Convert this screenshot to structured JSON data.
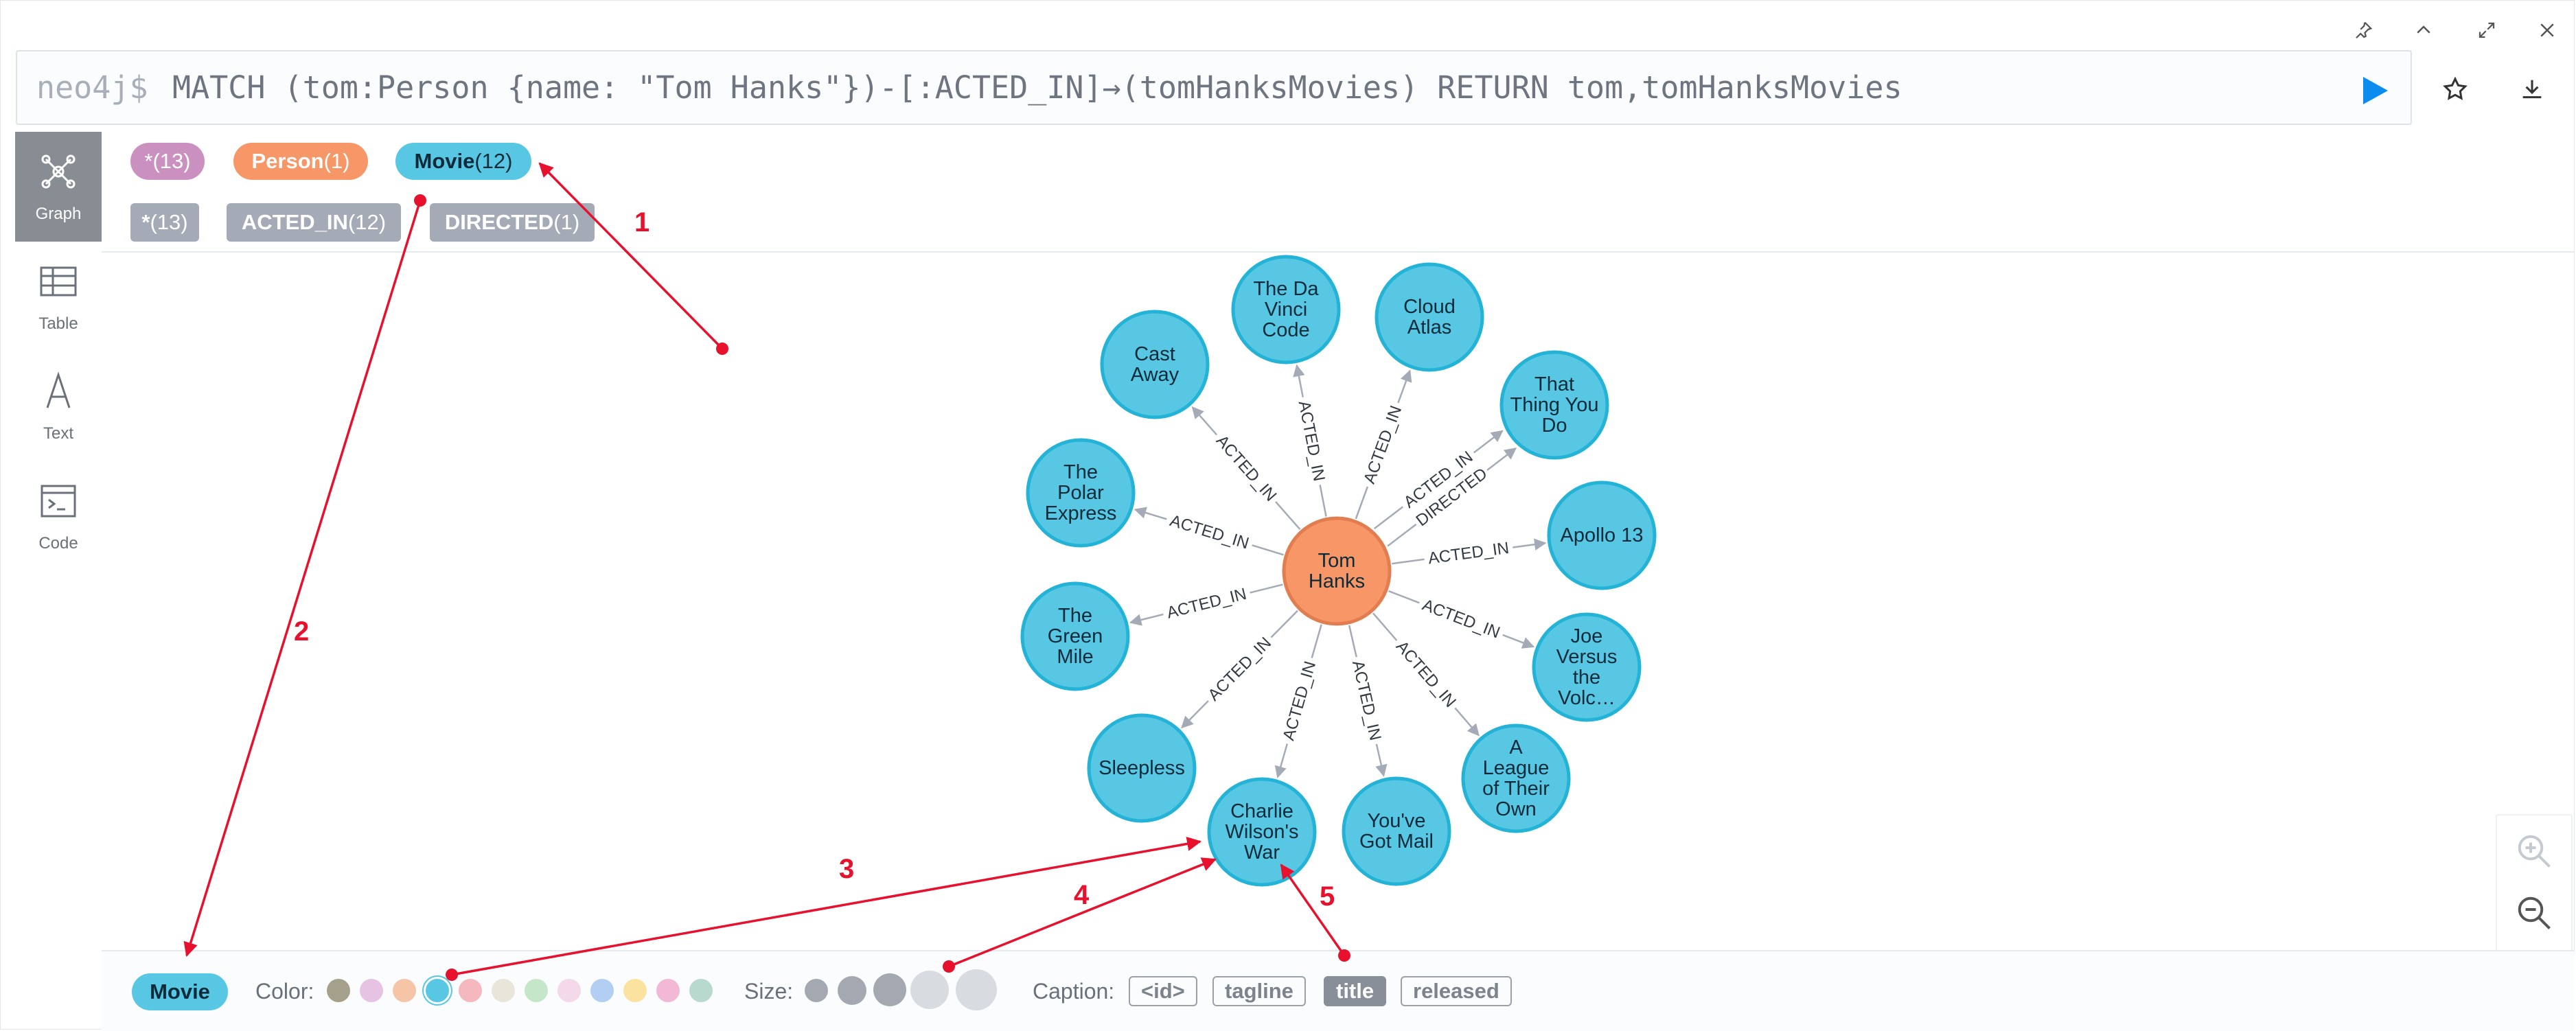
{
  "editor": {
    "prompt": "neo4j$",
    "query": "MATCH (tom:Person {name: \"Tom Hanks\"})-[:ACTED_IN]→(tomHanksMovies) RETURN tom,tomHanksMovies"
  },
  "window_controls": [
    "pin-icon",
    "collapse-icon",
    "fullscreen-icon",
    "close-icon"
  ],
  "editor_actions": [
    "play-icon",
    "star-icon",
    "download-icon"
  ],
  "sidebar": {
    "items": [
      {
        "label": "Graph",
        "icon": "graph-icon",
        "active": true
      },
      {
        "label": "Table",
        "icon": "table-icon",
        "active": false
      },
      {
        "label": "Text",
        "icon": "text-icon",
        "active": false
      },
      {
        "label": "Code",
        "icon": "code-icon",
        "active": false
      }
    ]
  },
  "node_labels": [
    {
      "name": "*",
      "count": "(13)",
      "color": "#c990c0"
    },
    {
      "name": "Person",
      "count": "(1)",
      "color": "#f79767"
    },
    {
      "name": "Movie",
      "count": "(12)",
      "color": "#57c7e3"
    }
  ],
  "rel_types": [
    {
      "name": "*",
      "count": "(13)"
    },
    {
      "name": "ACTED_IN",
      "count": "(12)"
    },
    {
      "name": "DIRECTED",
      "count": "(1)"
    }
  ],
  "graph": {
    "center": {
      "id": "tom",
      "lines": [
        "Tom",
        "Hanks"
      ],
      "color": "#f79767",
      "stroke": "#e27d50"
    },
    "movie_color": "#57c7e3",
    "movie_stroke": "#23b3d7",
    "edge_color": "#a5abb6",
    "movies": [
      {
        "id": "cast-away",
        "lines": [
          "Cast",
          "Away"
        ]
      },
      {
        "id": "da-vinci-code",
        "lines": [
          "The Da",
          "Vinci",
          "Code"
        ]
      },
      {
        "id": "cloud-atlas",
        "lines": [
          "Cloud",
          "Atlas"
        ]
      },
      {
        "id": "that-thing-you-do",
        "lines": [
          "That",
          "Thing You",
          "Do"
        ]
      },
      {
        "id": "polar-express",
        "lines": [
          "The",
          "Polar",
          "Express"
        ]
      },
      {
        "id": "apollo-13",
        "lines": [
          "Apollo 13"
        ]
      },
      {
        "id": "green-mile",
        "lines": [
          "The",
          "Green",
          "Mile"
        ]
      },
      {
        "id": "joe-versus-volcano",
        "lines": [
          "Joe",
          "Versus",
          "the",
          "Volc…"
        ]
      },
      {
        "id": "sleepless",
        "lines": [
          "Sleepless"
        ]
      },
      {
        "id": "league-of-their-own",
        "lines": [
          "A",
          "League",
          "of Their",
          "Own"
        ]
      },
      {
        "id": "charlie-wilsons-war",
        "lines": [
          "Charlie",
          "Wilson's",
          "War"
        ]
      },
      {
        "id": "youve-got-mail",
        "lines": [
          "You've",
          "Got Mail"
        ]
      }
    ],
    "edges": [
      {
        "target": "cast-away",
        "label": "ACTED_IN"
      },
      {
        "target": "da-vinci-code",
        "label": "ACTED_IN"
      },
      {
        "target": "cloud-atlas",
        "label": "ACTED_IN"
      },
      {
        "target": "that-thing-you-do",
        "label": "ACTED_IN"
      },
      {
        "target": "that-thing-you-do",
        "label": "DIRECTED"
      },
      {
        "target": "polar-express",
        "label": "ACTED_IN"
      },
      {
        "target": "apollo-13",
        "label": "ACTED_IN"
      },
      {
        "target": "green-mile",
        "label": "ACTED_IN"
      },
      {
        "target": "joe-versus-volcano",
        "label": "ACTED_IN"
      },
      {
        "target": "sleepless",
        "label": "ACTED_IN"
      },
      {
        "target": "league-of-their-own",
        "label": "ACTED_IN"
      },
      {
        "target": "charlie-wilsons-war",
        "label": "ACTED_IN"
      },
      {
        "target": "youve-got-mail",
        "label": "ACTED_IN"
      }
    ]
  },
  "zoom": [
    "zoom-in-icon",
    "zoom-out-icon"
  ],
  "bottom_bar": {
    "selected_label": "Movie",
    "selected_color": "#57c7e3",
    "color_label": "Color:",
    "colors": [
      "#a5a08a",
      "#e6c3e3",
      "#f6c5a8",
      "#57c7e3",
      "#f4b8be",
      "#e8e6da",
      "#c6e6c9",
      "#f3d9e9",
      "#b2cef2",
      "#fbe29f",
      "#f2b8d6",
      "#b8d9ce"
    ],
    "selected_color_index": 3,
    "size_label": "Size:",
    "sizes": 5,
    "selected_size_index": 3,
    "caption_label": "Caption:",
    "captions": [
      "<id>",
      "tagline",
      "title",
      "released"
    ],
    "selected_caption": "title"
  },
  "annotations": {
    "color": "#e8112d",
    "numbers": [
      "1",
      "2",
      "3",
      "4",
      "5"
    ]
  }
}
